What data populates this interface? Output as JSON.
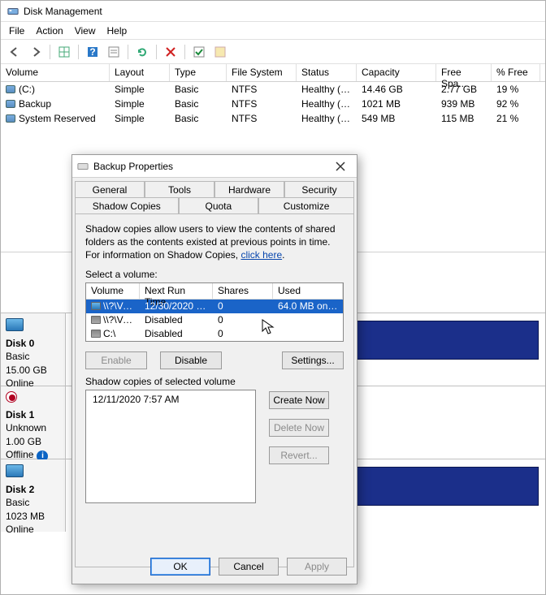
{
  "window": {
    "title": "Disk Management"
  },
  "menu": {
    "file": "File",
    "action": "Action",
    "view": "View",
    "help": "Help"
  },
  "columns": {
    "volume": "Volume",
    "layout": "Layout",
    "type": "Type",
    "fs": "File System",
    "status": "Status",
    "capacity": "Capacity",
    "free": "Free Spa...",
    "pct": "% Free"
  },
  "volumes": [
    {
      "name": "(C:)",
      "layout": "Simple",
      "type": "Basic",
      "fs": "NTFS",
      "status": "Healthy (B...",
      "capacity": "14.46 GB",
      "free": "2.77 GB",
      "pct": "19 %"
    },
    {
      "name": "Backup",
      "layout": "Simple",
      "type": "Basic",
      "fs": "NTFS",
      "status": "Healthy (P...",
      "capacity": "1021 MB",
      "free": "939 MB",
      "pct": "92 %"
    },
    {
      "name": "System Reserved",
      "layout": "Simple",
      "type": "Basic",
      "fs": "NTFS",
      "status": "Healthy (S...",
      "capacity": "549 MB",
      "free": "115 MB",
      "pct": "21 %"
    }
  ],
  "disks": [
    {
      "title": "Disk 0",
      "kind": "Basic",
      "size": "15.00 GB",
      "state": "Online"
    },
    {
      "title": "Disk 1",
      "kind": "Unknown",
      "size": "1.00 GB",
      "state": "Offline"
    },
    {
      "title": "Disk 2",
      "kind": "Basic",
      "size": "1023 MB",
      "state": "Online"
    }
  ],
  "dialog": {
    "title": "Backup Properties",
    "tabs": {
      "general": "General",
      "tools": "Tools",
      "hardware": "Hardware",
      "security": "Security",
      "shadow": "Shadow Copies",
      "quota": "Quota",
      "customize": "Customize"
    },
    "desc_pre": "Shadow copies allow users to view the contents of shared folders as the contents existed at previous points in time. For information on Shadow Copies, ",
    "desc_link": "click here",
    "desc_post": ".",
    "select_label": "Select a volume:",
    "vcols": {
      "volume": "Volume",
      "next": "Next Run Time",
      "shares": "Shares",
      "used": "Used"
    },
    "vrows": [
      {
        "vol": "\\\\?\\Vol...",
        "next": "12/30/2020 7...",
        "shares": "0",
        "used": "64.0 MB on ..."
      },
      {
        "vol": "\\\\?\\Vol...",
        "next": "Disabled",
        "shares": "0",
        "used": ""
      },
      {
        "vol": "C:\\",
        "next": "Disabled",
        "shares": "0",
        "used": ""
      }
    ],
    "buttons": {
      "enable": "Enable",
      "disable": "Disable",
      "settings": "Settings...",
      "create": "Create Now",
      "delete": "Delete Now",
      "revert": "Revert..."
    },
    "copies_label": "Shadow copies of selected volume",
    "copies": [
      "12/11/2020 7:57 AM"
    ],
    "ok": "OK",
    "cancel": "Cancel",
    "apply": "Apply"
  }
}
